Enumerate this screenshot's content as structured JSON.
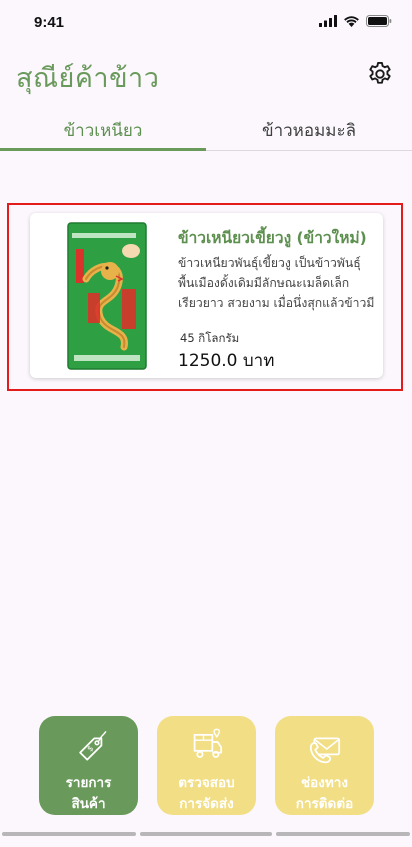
{
  "status_bar": {
    "time": "9:41"
  },
  "header": {
    "title": "สุณีย์ค้าข้าว"
  },
  "tabs": [
    {
      "label": "ข้าวเหนียว",
      "active": true
    },
    {
      "label": "ข้าวหอมมะลิ",
      "active": false
    }
  ],
  "products": [
    {
      "name": "ข้าวเหนียวเขี้ยวงู (ข้าวใหม่)",
      "description": "ข้าวเหนียวพันธุ์เขี้ยวงู เป็นข้าวพันธุ์พื้นเมืองดั้งเดิมมีลักษณะเมล็ดเล็ก เรียวยาว สวยงาม เมื่อนึ่งสุกแล้วข้าวมีสีขาว...",
      "weight": "45 กิโลกรัม",
      "price": "1250.0 บาท"
    }
  ],
  "bottom_nav": [
    {
      "label": "รายการ\nสินค้า",
      "icon": "price-tag-icon",
      "active": true
    },
    {
      "label": "ตรวจสอบ\nการจัดส่ง",
      "icon": "delivery-box-icon",
      "active": false
    },
    {
      "label": "ช่องทาง\nการติดต่อ",
      "icon": "contact-phone-icon",
      "active": false
    }
  ],
  "colors": {
    "primary": "#6a9a5b",
    "secondary": "#f2de85",
    "background": "#fbf7fd",
    "highlight": "#e41b1b"
  }
}
